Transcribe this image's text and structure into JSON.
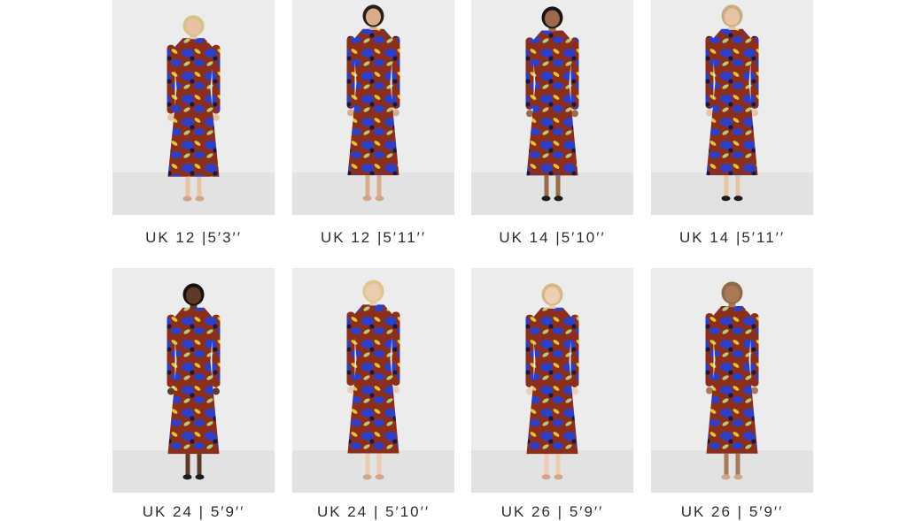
{
  "gallery": {
    "row1": [
      {
        "caption": "UK 12 |5′3′′",
        "hair": "#d8bf8c",
        "skin": "#e7c3a4",
        "shoes": "#d2a58a"
      },
      {
        "caption": "UK 12 |5′11′′",
        "hair": "#2a1d18",
        "skin": "#d9ad8c",
        "shoes": "#d2a58a"
      },
      {
        "caption": "UK 14 |5′10′′",
        "hair": "#1b1412",
        "skin": "#9a6a4c",
        "shoes": "#1c1c1c"
      },
      {
        "caption": "UK 14 |5′11′′",
        "hair": "#c9ad82",
        "skin": "#e8c4a6",
        "shoes": "#1c1c1c"
      }
    ],
    "row2": [
      {
        "caption": "UK 24 | 5′9′′",
        "hair": "#141010",
        "skin": "#5e3b29",
        "shoes": "#1c1c1c"
      },
      {
        "caption": "UK 24 | 5′10′′",
        "hair": "#e0c58e",
        "skin": "#ecccb0",
        "shoes": "#d2a58a"
      },
      {
        "caption": "UK 26 | 5′9′′",
        "hair": "#d6b886",
        "skin": "#edcfb5",
        "shoes": "#d2a58a"
      },
      {
        "caption": "UK 26 | 5′9′′",
        "hair": "#8f6b4a",
        "skin": "#a87a58",
        "shoes": "#d2a58a"
      }
    ]
  },
  "colors": {
    "dress_base": "#8c2e1c",
    "print_blue": "#2f3fc4",
    "print_yellow": "#e0c43a",
    "print_green": "#b9c97a",
    "print_navy": "#141a44",
    "background": "#ececec"
  }
}
